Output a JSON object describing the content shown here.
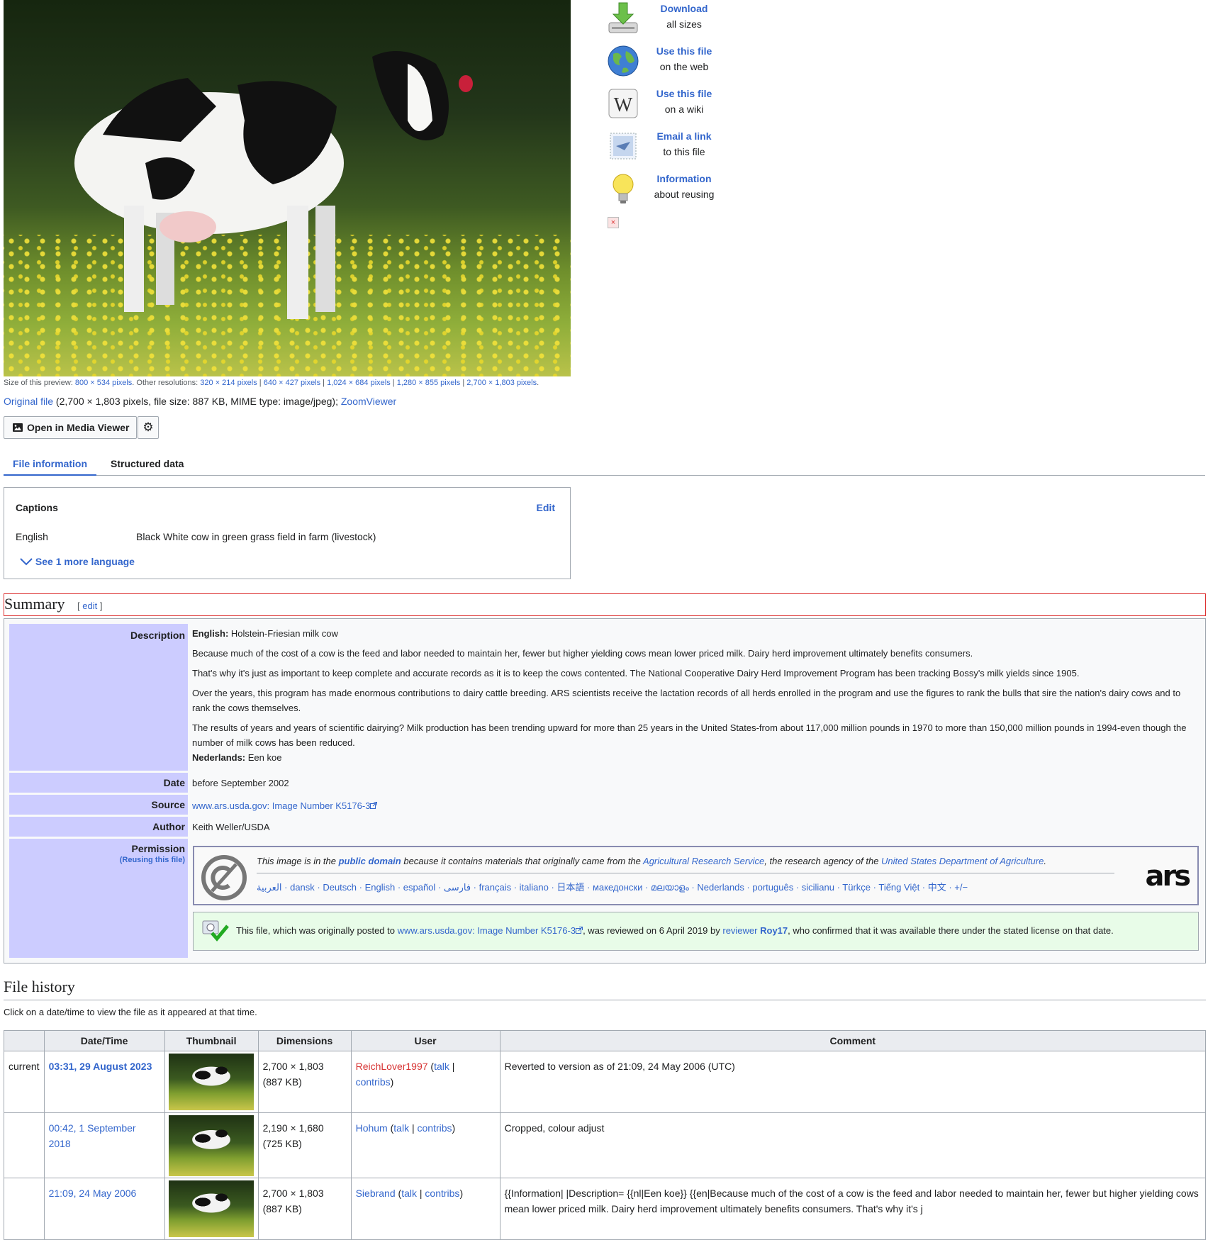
{
  "preview": {
    "alt": "Holstein-Friesian milk cow in a field of dandelions"
  },
  "preview_info": {
    "size_prefix": "Size of this preview: ",
    "size": "800 × 534 pixels",
    "other_prefix": ". Other resolutions: ",
    "resolutions": [
      "320 × 214 pixels",
      "640 × 427 pixels",
      "1,024 × 684 pixels",
      "1,280 × 855 pixels",
      "2,700 × 1,803 pixels"
    ],
    "sep": " | ",
    "end": "."
  },
  "original": {
    "link": "Original file",
    "details": " (2,700 × 1,803 pixels, file size: 887 KB, MIME type: image/jpeg); ",
    "zoom": "ZoomViewer"
  },
  "buttons": {
    "media_viewer": "Open in Media Viewer",
    "media_viewer_icon": "image-icon",
    "settings_icon": "gear-icon"
  },
  "actions": [
    {
      "title": "Download",
      "sub": "all sizes",
      "icon": "download-icon"
    },
    {
      "title": "Use this file",
      "sub": "on the web",
      "icon": "globe-icon"
    },
    {
      "title": "Use this file",
      "sub": "on a wiki",
      "icon": "wikipedia-icon"
    },
    {
      "title": "Email a link",
      "sub": "to this file",
      "icon": "email-icon"
    },
    {
      "title": "Information",
      "sub": "about reusing",
      "icon": "lightbulb-icon"
    }
  ],
  "broken_image_icon": "broken-image-icon",
  "tabs": [
    {
      "label": "File information",
      "active": true
    },
    {
      "label": "Structured data",
      "active": false
    }
  ],
  "captions": {
    "title": "Captions",
    "edit": "Edit",
    "language": "English",
    "text": "Black White cow in green grass field in farm (livestock)",
    "more": "See 1 more language"
  },
  "summary": {
    "heading": "Summary",
    "edit_open": "[ ",
    "edit": "edit",
    "edit_close": " ]",
    "description_label": "Description",
    "english_label": "English:",
    "english_title": " Holstein-Friesian milk cow",
    "paragraphs": [
      "Because much of the cost of a cow is the feed and labor needed to maintain her, fewer but higher yielding cows mean lower priced milk. Dairy herd improvement ultimately benefits consumers.",
      "That's why it's just as important to keep complete and accurate records as it is to keep the cows contented. The National Cooperative Dairy Herd Improvement Program has been tracking Bossy's milk yields since 1905.",
      "Over the years, this program has made enormous contributions to dairy cattle breeding. ARS scientists receive the lactation records of all herds enrolled in the program and use the figures to rank the bulls that sire the nation's dairy cows and to rank the cows themselves.",
      "The results of years and years of scientific dairying? Milk production has been trending upward for more than 25 years in the United States-from about 117,000 million pounds in 1970 to more than 150,000 million pounds in 1994-even though the number of milk cows has been reduced."
    ],
    "dutch_label": "Nederlands:",
    "dutch_text": " Een koe",
    "date_label": "Date",
    "date": "before September 2002",
    "source_label": "Source",
    "source": "www.ars.usda.gov: Image Number K5176-3",
    "external_link_icon": "external-link-icon",
    "author_label": "Author",
    "author": "Keith Weller/USDA",
    "permission_label": "Permission",
    "reusing": "(Reusing this file)",
    "pd": {
      "t1": "This image is in the ",
      "pd_link": "public domain",
      "t2": " because it contains materials that originally came from the ",
      "ars_link": "Agricultural Research Service",
      "t3": ", the research agency of the ",
      "usda_link": "United States Department of Agriculture",
      "t4": ".",
      "langs": "العربية · dansk · Deutsch · English · español · فارسی · français · italiano · 日本語 · македонски · മലയാളം · Nederlands · português · sicilianu · Türkçe · Tiếng Việt · 中文 · +/−",
      "pd_icon": "public-domain-icon",
      "ars_logo": "ars"
    },
    "review": {
      "t1": "This file, which was originally posted to ",
      "link": "www.ars.usda.gov: Image Number K5176-3",
      "t2": ", was reviewed on 6 April 2019 by ",
      "reviewer": "reviewer",
      "sp": " ",
      "user": "Roy17",
      "t3": ", who confirmed that it was available there under the stated license on that date.",
      "icon": "review-check-icon"
    }
  },
  "file_history": {
    "title": "File history",
    "subtitle": "Click on a date/time to view the file as it appeared at that time.",
    "headers": [
      "",
      "Date/Time",
      "Thumbnail",
      "Dimensions",
      "User",
      "Comment"
    ],
    "rows": [
      {
        "status": "current",
        "date": "03:31, 29 August 2023",
        "dims": "2,700 × 1,803",
        "size": "(887 KB)",
        "user": "ReichLover1997",
        "comment": "Reverted to version as of 21:09, 24 May 2006 (UTC)"
      },
      {
        "status": "",
        "date": "00:42, 1 September 2018",
        "dims": "2,190 × 1,680",
        "size": "(725 KB)",
        "user": "Hohum",
        "comment": "Cropped, colour adjust"
      },
      {
        "status": "",
        "date": "21:09, 24 May 2006",
        "dims": "2,700 × 1,803",
        "size": "(887 KB)",
        "user": "Siebrand",
        "comment": "{{Information| |Description= {{nl|Een koe}} {{en|Because much of the cost of a cow is the feed and labor needed to maintain her, fewer but higher yielding cows mean lower priced milk. Dairy herd improvement ultimately benefits consumers. That's why it's j"
      }
    ],
    "talk": "talk",
    "contribs": "contribs"
  }
}
